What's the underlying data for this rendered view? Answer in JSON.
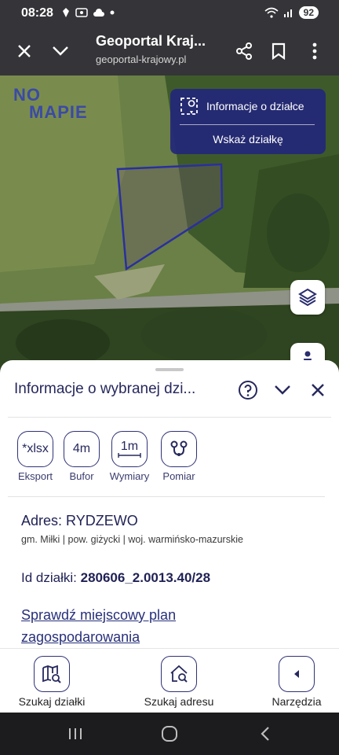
{
  "status_bar": {
    "time": "08:28",
    "battery": "92"
  },
  "browser": {
    "title": "Geoportal Kraj...",
    "url": "geoportal-krajowy.pl"
  },
  "map": {
    "logo_line1": "NO",
    "logo_line2": "MAPIE",
    "info_panel": {
      "parcel_info": "Informacje o działce",
      "point_parcel": "Wskaż działkę"
    }
  },
  "sheet": {
    "title": "Informacje o wybranej dzi...",
    "tools": [
      {
        "icon_text": "*xlsx",
        "label": "Eksport"
      },
      {
        "icon_text": "4m",
        "label": "Bufor"
      },
      {
        "icon_text": "1m",
        "label": "Wymiary"
      },
      {
        "icon_text": "",
        "label": "Pomiar"
      }
    ],
    "address": "Adres: RYDZEWO",
    "address_details": "gm. Miłki | pow. giżycki | woj. warmińsko-mazurskie",
    "id_label": "Id działki:",
    "id_value": "280606_2.0013.40/28",
    "plan_link": "Sprawdź miejscowy plan zagospodarowania"
  },
  "bottom_nav": [
    {
      "label": "Szukaj działki",
      "icon": "map-search-icon"
    },
    {
      "label": "Szukaj adresu",
      "icon": "home-search-icon"
    },
    {
      "label": "Narzędzia",
      "icon": "caret-left-icon"
    }
  ],
  "colors": {
    "primary": "#26285d",
    "panel": "#232778",
    "parcel_outline": "#2a2fa0"
  }
}
